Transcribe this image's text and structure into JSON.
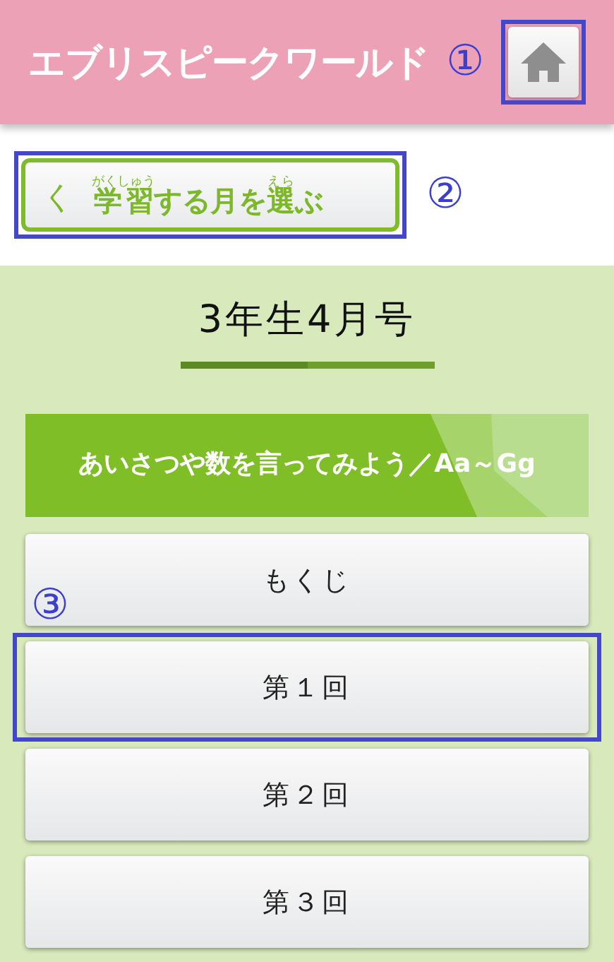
{
  "header": {
    "logo": "エブリスピークワールド",
    "callout": "①"
  },
  "back_button": {
    "arrow": "く",
    "segments": [
      {
        "text": "学習",
        "ruby": "がくしゅう"
      },
      {
        "text": "する月を"
      },
      {
        "text": "選",
        "ruby": "えら"
      },
      {
        "text": "ぶ"
      }
    ],
    "callout": "②"
  },
  "issue_title": "3年生4月号",
  "unit_banner": "あいさつや数を言ってみよう／Aa～Gg",
  "lessons": [
    {
      "label": "もくじ"
    },
    {
      "label": "第１回",
      "callout": "③"
    },
    {
      "label": "第２回"
    },
    {
      "label": "第３回"
    }
  ]
}
